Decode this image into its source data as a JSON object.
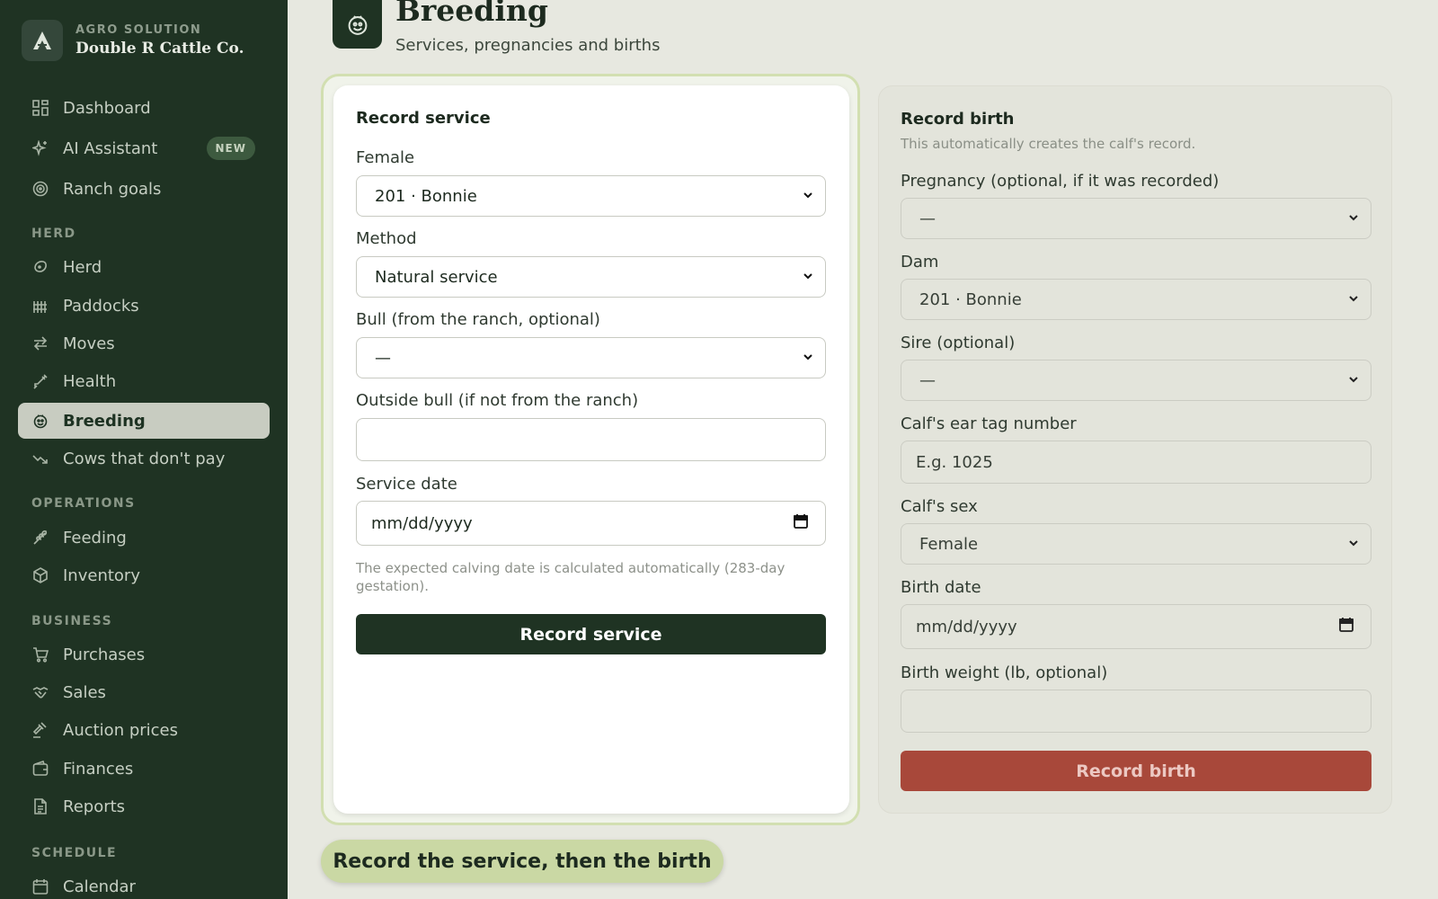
{
  "brand": {
    "subtitle": "AGRO SOLUTION",
    "name": "Double R Cattle Co."
  },
  "sidebar": {
    "items": [
      {
        "label": "Dashboard",
        "icon": "grid-icon"
      },
      {
        "label": "AI Assistant",
        "icon": "sparkle-icon",
        "badge": "NEW"
      },
      {
        "label": "Ranch goals",
        "icon": "target-icon"
      }
    ],
    "herd_label": "HERD",
    "herd": [
      {
        "label": "Herd",
        "icon": "cow-icon"
      },
      {
        "label": "Paddocks",
        "icon": "fence-icon"
      },
      {
        "label": "Moves",
        "icon": "arrows-icon"
      },
      {
        "label": "Health",
        "icon": "syringe-icon"
      },
      {
        "label": "Breeding",
        "icon": "breeding-icon",
        "active": true
      },
      {
        "label": "Cows that don't pay",
        "icon": "trend-down-icon"
      }
    ],
    "operations_label": "OPERATIONS",
    "operations": [
      {
        "label": "Feeding",
        "icon": "wheat-icon"
      },
      {
        "label": "Inventory",
        "icon": "box-icon"
      }
    ],
    "business_label": "BUSINESS",
    "business": [
      {
        "label": "Purchases",
        "icon": "cart-icon"
      },
      {
        "label": "Sales",
        "icon": "handshake-icon"
      },
      {
        "label": "Auction prices",
        "icon": "gavel-icon"
      },
      {
        "label": "Finances",
        "icon": "wallet-icon"
      },
      {
        "label": "Reports",
        "icon": "document-icon"
      }
    ],
    "schedule_label": "SCHEDULE",
    "schedule": [
      {
        "label": "Calendar",
        "icon": "calendar-icon"
      }
    ]
  },
  "header": {
    "title": "Breeding",
    "subtitle": "Services, pregnancies and births"
  },
  "service": {
    "title": "Record service",
    "female_label": "Female",
    "female_value": "201 · Bonnie",
    "method_label": "Method",
    "method_value": "Natural service",
    "bull_label": "Bull (from the ranch, optional)",
    "bull_value": "—",
    "outside_bull_label": "Outside bull (if not from the ranch)",
    "outside_bull_value": "",
    "date_label": "Service date",
    "date_value": "mm/dd/yyyy",
    "note": "The expected calving date is calculated automatically (283-day gestation).",
    "button": "Record service"
  },
  "birth": {
    "title": "Record birth",
    "hint": "This automatically creates the calf's record.",
    "pregnancy_label": "Pregnancy (optional, if it was recorded)",
    "pregnancy_value": "—",
    "dam_label": "Dam",
    "dam_value": "201 · Bonnie",
    "sire_label": "Sire (optional)",
    "sire_value": "—",
    "ear_tag_label": "Calf's ear tag number",
    "ear_tag_placeholder": "E.g. 1025",
    "sex_label": "Calf's sex",
    "sex_value": "Female",
    "date_label": "Birth date",
    "date_value": "mm/dd/yyyy",
    "weight_label": "Birth weight (lb, optional)",
    "weight_value": "",
    "button": "Record birth"
  },
  "callout": "Record the service, then the birth",
  "colors": {
    "sidebar": "#1f3323",
    "accent": "#1f3323",
    "birth_button": "#a8483a",
    "callout": "#cad8a4"
  }
}
